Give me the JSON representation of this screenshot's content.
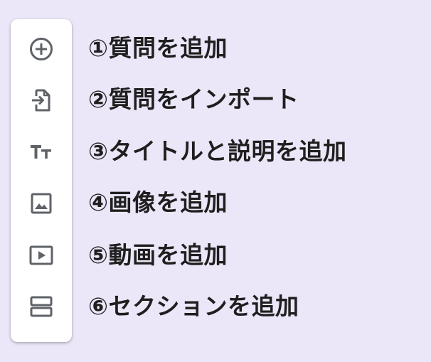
{
  "labels": {
    "add_question": "①質問を追加",
    "import_questions": "②質問をインポート",
    "add_title": "③タイトルと説明を追加",
    "add_image": "④画像を追加",
    "add_video": "⑤動画を追加",
    "add_section": "⑥セクションを追加"
  },
  "icons": {
    "add_question": "add-circle-icon",
    "import_questions": "import-file-icon",
    "add_title": "title-text-icon",
    "add_image": "image-icon",
    "add_video": "video-icon",
    "add_section": "section-icon"
  },
  "colors": {
    "background": "#ece7f8",
    "toolbar": "#ffffff",
    "icon": "#5f6368",
    "text": "#1f1f1f"
  }
}
